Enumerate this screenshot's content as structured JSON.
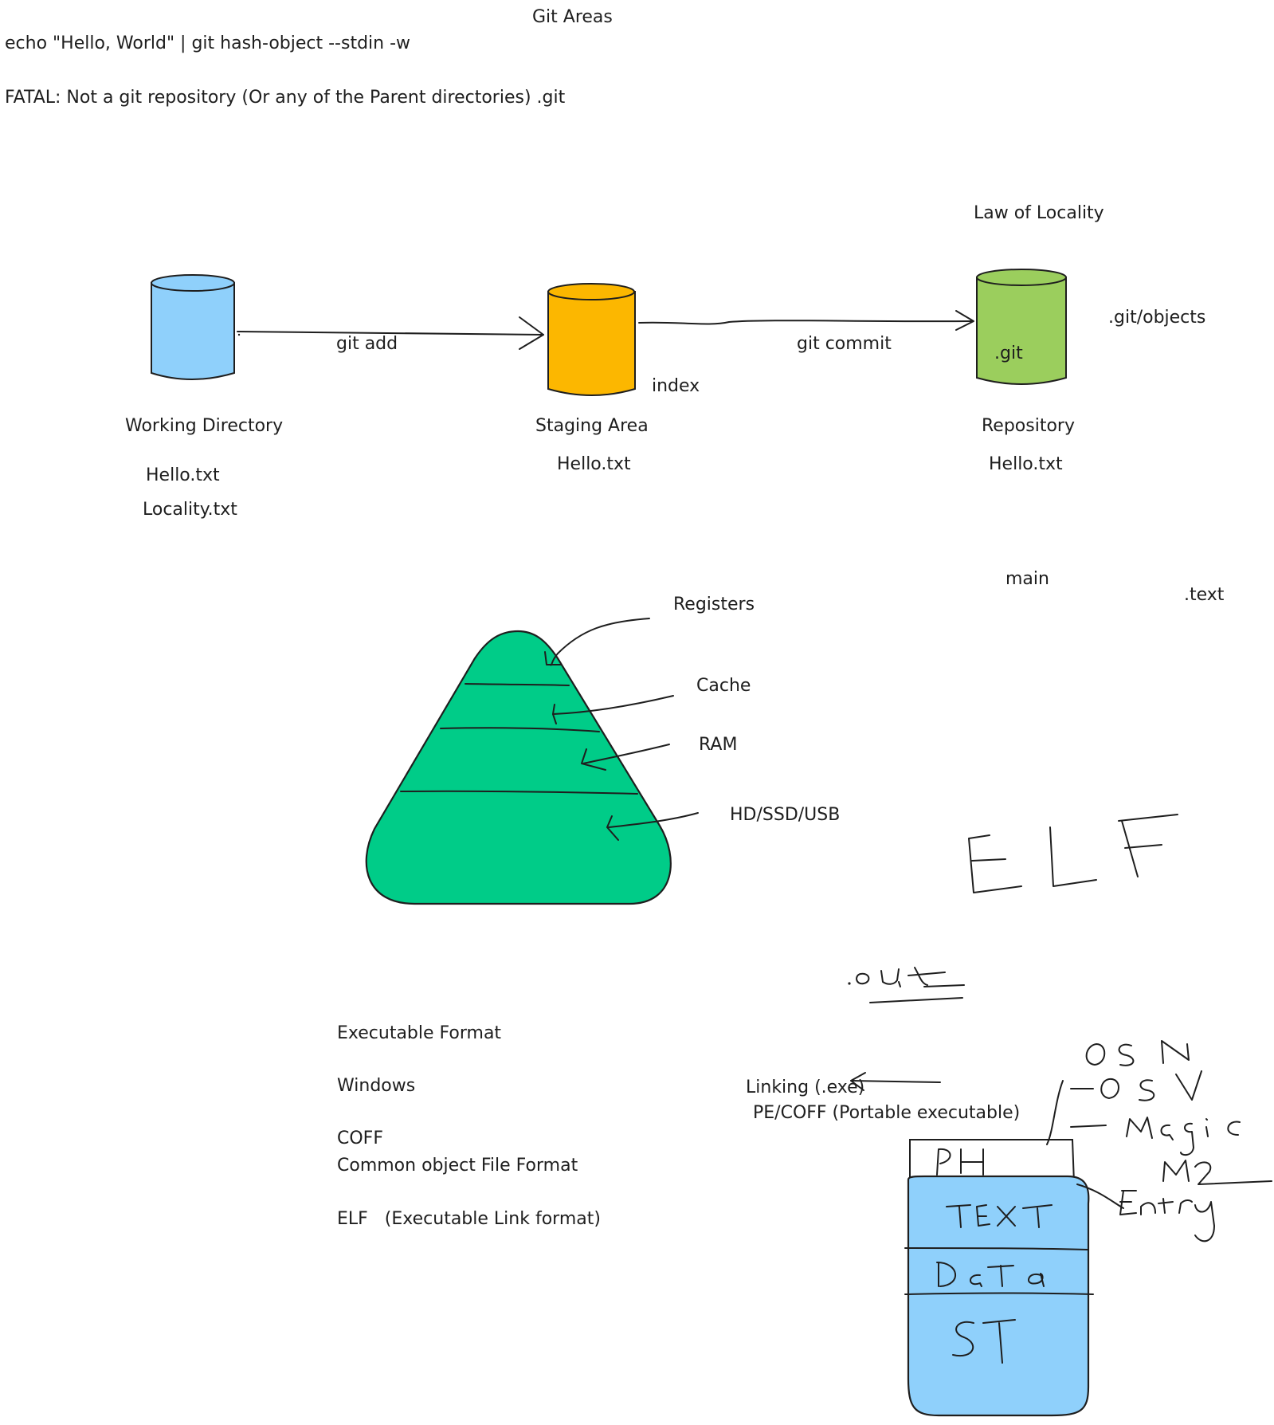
{
  "header": {
    "title": "Git Areas",
    "command": "echo \"Hello, World\" | git hash-object --stdin -w",
    "error": "FATAL: Not a git repository (Or any of the Parent directories) .git"
  },
  "git_areas": {
    "law_label": "Law of Locality",
    "working": {
      "label": "Working Directory",
      "files": [
        "Hello.txt",
        "Locality.txt"
      ],
      "color": "#8fd0fb"
    },
    "add_arrow": "git add",
    "staging": {
      "label": "Staging Area",
      "alias": "index",
      "files": [
        "Hello.txt"
      ],
      "color": "#fcb700"
    },
    "commit_arrow": "git commit",
    "repository": {
      "label": "Repository",
      "inner": ".git",
      "path": ".git/objects",
      "files": [
        "Hello.txt"
      ],
      "color": "#9bce5d"
    }
  },
  "misc": {
    "main": "main",
    "text_section": ".text"
  },
  "memory_pyramid": {
    "color": "#00cc88",
    "levels": [
      "Registers",
      "Cache",
      "RAM",
      "HD/SSD/USB"
    ]
  },
  "handwriting": {
    "elf": "ELF",
    "out": ".out",
    "header_fields": [
      "OS N",
      "-OSV",
      "-Magic",
      "M2",
      "Entry"
    ],
    "sections": [
      "PH",
      "TEXT",
      "Data",
      "ST"
    ]
  },
  "formats": {
    "title": "Executable Format",
    "windows": "Windows",
    "coff": "COFF",
    "coff_full": "Common object File Format",
    "elf": "ELF   (Executable Link format)",
    "linking": "Linking (.exe)",
    "pe": "PE/COFF (Portable executable)"
  },
  "colors": {
    "stroke": "#1e1e1e",
    "elf_box": "#8fd0fb"
  }
}
